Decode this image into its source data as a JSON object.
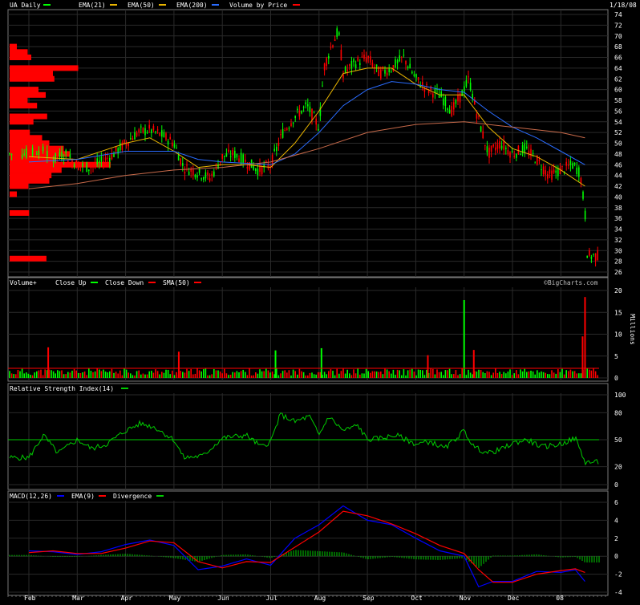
{
  "header": {
    "symbol_label": "UA Daily",
    "date": "1/18/08",
    "legend": [
      {
        "label": "EMA(21)",
        "color": "#e8b400"
      },
      {
        "label": "EMA(50)",
        "color": "#e8b400"
      },
      {
        "label": "EMA(200)",
        "color": "#2a6cff"
      },
      {
        "label": "Volume by Price",
        "color": "#ff0000"
      }
    ]
  },
  "watermark": "©BigCharts.com",
  "colors": {
    "up": "#00ff00",
    "down": "#ff0000",
    "ema21": "#e8b400",
    "ema50": "#2a6cff",
    "ema200": "#c86a4a",
    "grid": "#2a2a2a",
    "rsi": "#00cc00",
    "macd": "#0000ff",
    "signal": "#ff0000",
    "divergence": "#00cc00"
  },
  "months": [
    "Feb",
    "Mar",
    "Apr",
    "May",
    "Jun",
    "Jul",
    "Aug",
    "Sep",
    "Oct",
    "Nov",
    "Dec",
    "08"
  ],
  "chart_data": [
    {
      "type": "candlestick",
      "title": "UA Daily",
      "ylim": [
        26,
        74
      ],
      "y_ticks": [
        26,
        28,
        30,
        32,
        34,
        36,
        38,
        40,
        42,
        44,
        46,
        48,
        50,
        52,
        54,
        56,
        58,
        60,
        62,
        64,
        66,
        68,
        70,
        72,
        74
      ],
      "x_month_index": [
        0,
        1,
        2,
        3,
        4,
        5,
        6,
        7,
        8,
        9,
        10,
        11
      ],
      "price_path": [
        [
          0,
          48
        ],
        [
          0.25,
          49
        ],
        [
          0.5,
          47
        ],
        [
          0.75,
          48
        ],
        [
          1.0,
          46
        ],
        [
          1.25,
          45.5
        ],
        [
          1.5,
          46.5
        ],
        [
          1.75,
          48
        ],
        [
          2.0,
          50
        ],
        [
          2.25,
          52
        ],
        [
          2.5,
          52.5
        ],
        [
          2.75,
          51.5
        ],
        [
          3.0,
          50
        ],
        [
          3.2,
          45.5
        ],
        [
          3.5,
          44.5
        ],
        [
          3.75,
          43.5
        ],
        [
          4.0,
          47.5
        ],
        [
          4.25,
          48
        ],
        [
          4.5,
          46.5
        ],
        [
          4.75,
          45
        ],
        [
          5.0,
          46
        ],
        [
          5.25,
          52
        ],
        [
          5.5,
          55
        ],
        [
          5.75,
          57
        ],
        [
          6.0,
          53
        ],
        [
          6.1,
          64
        ],
        [
          6.25,
          68
        ],
        [
          6.4,
          71
        ],
        [
          6.5,
          63
        ],
        [
          6.75,
          65
        ],
        [
          7.0,
          66
        ],
        [
          7.25,
          63
        ],
        [
          7.5,
          64
        ],
        [
          7.75,
          66
        ],
        [
          8.0,
          62
        ],
        [
          8.25,
          60
        ],
        [
          8.5,
          59
        ],
        [
          8.75,
          56
        ],
        [
          9.0,
          60
        ],
        [
          9.1,
          62
        ],
        [
          9.25,
          56
        ],
        [
          9.5,
          48
        ],
        [
          9.75,
          50
        ],
        [
          10.0,
          48
        ],
        [
          10.25,
          49
        ],
        [
          10.5,
          47
        ],
        [
          10.75,
          44
        ],
        [
          11.0,
          45
        ],
        [
          11.25,
          46
        ],
        [
          11.4,
          44.5
        ],
        [
          11.5,
          37
        ],
        [
          11.55,
          29
        ]
      ],
      "series": [
        {
          "name": "EMA(21)",
          "points": [
            [
              0,
              47.5
            ],
            [
              1,
              47
            ],
            [
              2,
              50
            ],
            [
              2.5,
              51
            ],
            [
              3,
              48.5
            ],
            [
              3.5,
              45.5
            ],
            [
              4,
              46
            ],
            [
              4.5,
              46
            ],
            [
              5,
              45.5
            ],
            [
              5.5,
              50
            ],
            [
              6,
              56
            ],
            [
              6.5,
              63
            ],
            [
              7,
              64
            ],
            [
              7.5,
              64
            ],
            [
              8,
              61
            ],
            [
              8.5,
              59
            ],
            [
              9,
              59
            ],
            [
              9.5,
              53
            ],
            [
              10,
              49
            ],
            [
              10.5,
              47.5
            ],
            [
              11,
              45
            ],
            [
              11.5,
              42
            ]
          ]
        },
        {
          "name": "EMA(50)",
          "points": [
            [
              0,
              46.5
            ],
            [
              1,
              47
            ],
            [
              2,
              48.5
            ],
            [
              3,
              48.5
            ],
            [
              3.5,
              47
            ],
            [
              4,
              46.5
            ],
            [
              5,
              46
            ],
            [
              5.5,
              48
            ],
            [
              6,
              52
            ],
            [
              6.5,
              57
            ],
            [
              7,
              60
            ],
            [
              7.5,
              61.5
            ],
            [
              8,
              61
            ],
            [
              8.5,
              60
            ],
            [
              9,
              59.5
            ],
            [
              9.5,
              56
            ],
            [
              10,
              53
            ],
            [
              10.5,
              51
            ],
            [
              11,
              48.5
            ],
            [
              11.5,
              46
            ]
          ]
        },
        {
          "name": "EMA(200)",
          "points": [
            [
              0,
              41.5
            ],
            [
              1,
              42.5
            ],
            [
              2,
              44
            ],
            [
              3,
              45
            ],
            [
              4,
              45.5
            ],
            [
              5,
              46.5
            ],
            [
              6,
              49
            ],
            [
              7,
              52
            ],
            [
              8,
              53.5
            ],
            [
              9,
              54
            ],
            [
              10,
              53
            ],
            [
              11,
              52
            ],
            [
              11.5,
              51
            ]
          ]
        }
      ],
      "volume_by_price": [
        {
          "price": 68,
          "value": 1.0
        },
        {
          "price": 67,
          "value": 2.5
        },
        {
          "price": 66,
          "value": 3.0
        },
        {
          "price": 64,
          "value": 9.5
        },
        {
          "price": 63,
          "value": 6.0
        },
        {
          "price": 62,
          "value": 6.2
        },
        {
          "price": 60,
          "value": 4.0
        },
        {
          "price": 59,
          "value": 5.0
        },
        {
          "price": 58,
          "value": 2.5
        },
        {
          "price": 57,
          "value": 3.8
        },
        {
          "price": 55,
          "value": 5.2
        },
        {
          "price": 54,
          "value": 3.3
        },
        {
          "price": 52,
          "value": 2.8
        },
        {
          "price": 51,
          "value": 4.5
        },
        {
          "price": 50,
          "value": 5.5
        },
        {
          "price": 49,
          "value": 7.5
        },
        {
          "price": 48,
          "value": 8.4
        },
        {
          "price": 47,
          "value": 6.5
        },
        {
          "price": 46,
          "value": 14.0
        },
        {
          "price": 45,
          "value": 7.2
        },
        {
          "price": 44,
          "value": 5.8
        },
        {
          "price": 43,
          "value": 5.5
        },
        {
          "price": 42,
          "value": 2.6
        },
        {
          "price": 40.5,
          "value": 1.0
        },
        {
          "price": 37,
          "value": 2.7
        },
        {
          "price": 28.5,
          "value": 5.1
        }
      ]
    },
    {
      "type": "bar",
      "title": "Volume+",
      "legend": [
        {
          "label": "Close Up",
          "color": "#00ff00"
        },
        {
          "label": "Close Down",
          "color": "#ff0000"
        },
        {
          "label": "SMA(50)",
          "color": "#ff0000"
        }
      ],
      "ylabel": "Millions",
      "ylim": [
        0,
        20
      ],
      "y_ticks": [
        0,
        5,
        10,
        15,
        20
      ],
      "spikes": [
        {
          "x": 0.4,
          "value": 7.0,
          "up": false
        },
        {
          "x": 3.1,
          "value": 6.0,
          "up": false
        },
        {
          "x": 5.1,
          "value": 6.3,
          "up": true
        },
        {
          "x": 6.05,
          "value": 6.8,
          "up": true
        },
        {
          "x": 8.25,
          "value": 5.2,
          "up": false
        },
        {
          "x": 9.0,
          "value": 17.8,
          "up": true
        },
        {
          "x": 9.2,
          "value": 6.4,
          "up": false
        },
        {
          "x": 11.45,
          "value": 9.5,
          "up": false
        },
        {
          "x": 11.5,
          "value": 18.5,
          "up": false
        }
      ],
      "baseline_level": 1.8,
      "sma_level": 2.2
    },
    {
      "type": "line",
      "title": "Relative Strength Index(14)",
      "ylim": [
        0,
        100
      ],
      "y_ticks": [
        0,
        20,
        50,
        80,
        100
      ],
      "reference_line": 50,
      "values": [
        [
          0,
          30
        ],
        [
          0.3,
          55
        ],
        [
          0.6,
          35
        ],
        [
          1.0,
          50
        ],
        [
          1.3,
          40
        ],
        [
          1.6,
          45
        ],
        [
          2.0,
          60
        ],
        [
          2.3,
          68
        ],
        [
          2.6,
          64
        ],
        [
          3.0,
          50
        ],
        [
          3.2,
          30
        ],
        [
          3.6,
          32
        ],
        [
          4.0,
          52
        ],
        [
          4.5,
          55
        ],
        [
          4.8,
          42
        ],
        [
          5.0,
          48
        ],
        [
          5.2,
          78
        ],
        [
          5.5,
          70
        ],
        [
          5.8,
          76
        ],
        [
          6.0,
          55
        ],
        [
          6.2,
          76
        ],
        [
          6.5,
          60
        ],
        [
          6.8,
          66
        ],
        [
          7.0,
          50
        ],
        [
          7.3,
          52
        ],
        [
          7.6,
          55
        ],
        [
          8.0,
          45
        ],
        [
          8.3,
          48
        ],
        [
          8.6,
          40
        ],
        [
          9.0,
          60
        ],
        [
          9.2,
          42
        ],
        [
          9.5,
          35
        ],
        [
          9.8,
          40
        ],
        [
          10.0,
          46
        ],
        [
          10.3,
          50
        ],
        [
          10.6,
          42
        ],
        [
          11.0,
          45
        ],
        [
          11.3,
          52
        ],
        [
          11.5,
          25
        ]
      ]
    },
    {
      "type": "line",
      "title": "MACD(12,26)",
      "legend": [
        {
          "label": "MACD(12,26)",
          "color": "#0000ff"
        },
        {
          "label": "EMA(9)",
          "color": "#ff0000"
        },
        {
          "label": "Divergence",
          "color": "#00cc00"
        }
      ],
      "ylim": [
        -4,
        6
      ],
      "y_ticks": [
        -4,
        -2,
        0,
        2,
        4,
        6
      ],
      "series": [
        {
          "name": "MACD(12,26)",
          "points": [
            [
              0,
              0.6
            ],
            [
              0.5,
              0.5
            ],
            [
              1.0,
              0.2
            ],
            [
              1.5,
              0.5
            ],
            [
              2.0,
              1.3
            ],
            [
              2.5,
              1.8
            ],
            [
              3.0,
              1.2
            ],
            [
              3.5,
              -1.5
            ],
            [
              4.0,
              -1.1
            ],
            [
              4.5,
              -0.3
            ],
            [
              5.0,
              -1.0
            ],
            [
              5.5,
              2.0
            ],
            [
              6.0,
              3.5
            ],
            [
              6.5,
              5.6
            ],
            [
              7.0,
              4.0
            ],
            [
              7.5,
              3.5
            ],
            [
              8.0,
              2.0
            ],
            [
              8.5,
              0.6
            ],
            [
              9.0,
              0.0
            ],
            [
              9.3,
              -3.4
            ],
            [
              9.6,
              -2.8
            ],
            [
              10.0,
              -2.8
            ],
            [
              10.5,
              -1.7
            ],
            [
              11.0,
              -1.8
            ],
            [
              11.3,
              -1.5
            ],
            [
              11.5,
              -2.8
            ]
          ]
        },
        {
          "name": "MACD EMA(9)",
          "points": [
            [
              0,
              0.4
            ],
            [
              0.5,
              0.6
            ],
            [
              1.0,
              0.3
            ],
            [
              1.5,
              0.3
            ],
            [
              2.0,
              0.9
            ],
            [
              2.5,
              1.7
            ],
            [
              3.0,
              1.5
            ],
            [
              3.5,
              -0.6
            ],
            [
              4.0,
              -1.3
            ],
            [
              4.5,
              -0.6
            ],
            [
              5.0,
              -0.7
            ],
            [
              5.5,
              1.0
            ],
            [
              6.0,
              2.7
            ],
            [
              6.5,
              5.0
            ],
            [
              7.0,
              4.5
            ],
            [
              7.5,
              3.6
            ],
            [
              8.0,
              2.5
            ],
            [
              8.5,
              1.2
            ],
            [
              9.0,
              0.3
            ],
            [
              9.3,
              -1.5
            ],
            [
              9.6,
              -2.9
            ],
            [
              10.0,
              -2.9
            ],
            [
              10.5,
              -2.0
            ],
            [
              11.0,
              -1.6
            ],
            [
              11.3,
              -1.4
            ],
            [
              11.5,
              -1.8
            ]
          ]
        }
      ]
    }
  ]
}
